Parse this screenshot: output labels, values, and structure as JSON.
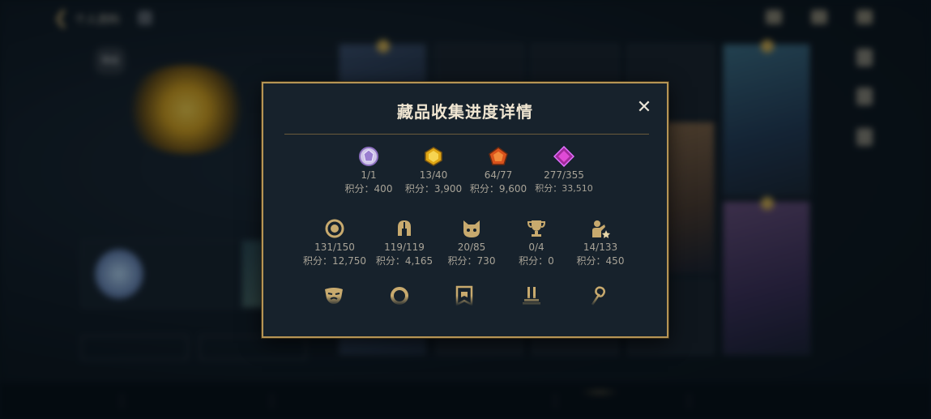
{
  "header": {
    "title": "个人资料"
  },
  "profile": {
    "badge": "等级",
    "name": "藏品收集进度详情",
    "promo_text": "藏品收集进度"
  },
  "modal": {
    "title": "藏品收集进度详情",
    "close_symbol": "✕",
    "gems": [
      {
        "icon": "diamond-gem-icon",
        "count": "1/1",
        "score": "积分：400"
      },
      {
        "icon": "gold-gem-icon",
        "count": "13/40",
        "score": "积分：3,900"
      },
      {
        "icon": "orange-gem-icon",
        "count": "64/77",
        "score": "积分：9,600"
      },
      {
        "icon": "purple-gem-icon",
        "count": "277/355",
        "score": "积分：33,510"
      }
    ],
    "categories": [
      {
        "icon": "ring-icon",
        "count": "131/150",
        "score": "积分：12,750"
      },
      {
        "icon": "helmet-icon",
        "count": "119/119",
        "score": "积分：4,165"
      },
      {
        "icon": "pet-icon",
        "count": "20/85",
        "score": "积分：730"
      },
      {
        "icon": "trophy-icon",
        "count": "0/4",
        "score": "积分：0"
      },
      {
        "icon": "emote-icon",
        "count": "14/133",
        "score": "积分：450"
      }
    ],
    "row3_icons": [
      "mask-icon",
      "circle-frame-icon",
      "banner-icon",
      "statue-icon",
      "hook-icon"
    ]
  },
  "colors": {
    "accent_gold": "#b69555",
    "modal_bg": "#17222c",
    "icon_gold": "#c8aa6e",
    "text_muted": "#a8a397"
  }
}
